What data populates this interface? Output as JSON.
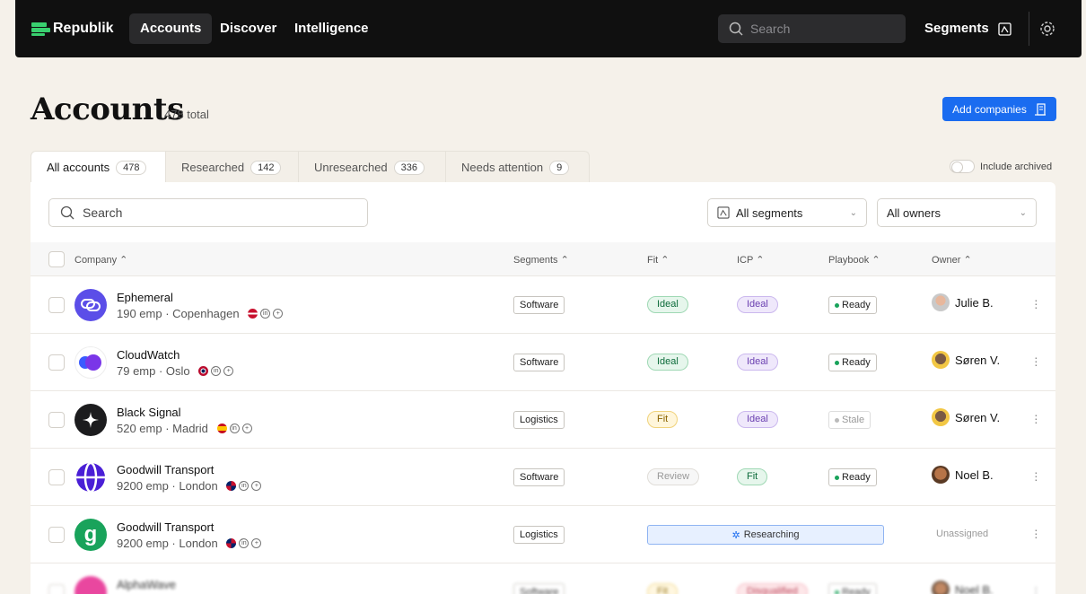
{
  "nav": {
    "brand": "Republik",
    "links": [
      "Accounts",
      "Discover",
      "Intelligence"
    ],
    "search_placeholder": "Search",
    "segments_label": "Segments"
  },
  "header": {
    "title": "Accounts",
    "total": "478 total",
    "add_button": "Add companies"
  },
  "tabs": [
    {
      "label": "All accounts",
      "count": "478"
    },
    {
      "label": "Researched",
      "count": "142"
    },
    {
      "label": "Unresearched",
      "count": "336"
    },
    {
      "label": "Needs attention",
      "count": "9"
    }
  ],
  "include_archived": "Include archived",
  "filters": {
    "search_placeholder": "Search",
    "segments": "All segments",
    "owners": "All owners"
  },
  "columns": [
    "Company",
    "Segments",
    "Fit",
    "ICP",
    "Playbook",
    "Owner"
  ],
  "rows": [
    {
      "name": "Ephemeral",
      "meta": "190 emp · Copenhagen",
      "segment": "Software",
      "fit": "Ideal",
      "icp": "Ideal",
      "playbook": "Ready",
      "owner": "Julie B."
    },
    {
      "name": "CloudWatch",
      "meta": "79 emp · Oslo",
      "segment": "Software",
      "fit": "Ideal",
      "icp": "Ideal",
      "playbook": "Ready",
      "owner": "Søren V."
    },
    {
      "name": "Black Signal",
      "meta": "520 emp · Madrid",
      "segment": "Logistics",
      "fit": "Fit",
      "icp": "Ideal",
      "playbook": "Stale",
      "owner": "Søren V."
    },
    {
      "name": "Goodwill Transport",
      "meta": "9200 emp · London",
      "segment": "Software",
      "fit": "Review",
      "icp": "Fit",
      "playbook": "Ready",
      "owner": "Noel B."
    },
    {
      "name": "Goodwill Transport",
      "meta": "9200 emp · London",
      "segment": "Logistics",
      "status": "Researching",
      "owner": "Unassigned"
    },
    {
      "name": "AlphaWave",
      "segment": "Software",
      "fit": "Fit",
      "icp": "Disqualified",
      "playbook": "Ready",
      "owner": "Noel B."
    }
  ],
  "colors": {
    "accent": "#1a6cf0",
    "brand_green": "#39d06f",
    "nav_bg": "#101010",
    "page_bg": "#f5f1ea"
  }
}
